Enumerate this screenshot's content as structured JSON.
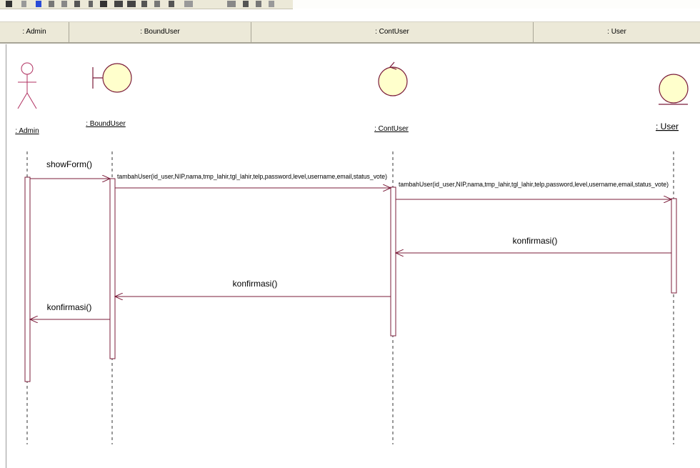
{
  "columns": [
    {
      "label": ": Admin"
    },
    {
      "label": ": BoundUser"
    },
    {
      "label": ": ContUser"
    },
    {
      "label": ": User"
    }
  ],
  "lifelines": [
    {
      "name": ": Admin",
      "kind": "actor-icon"
    },
    {
      "name": ": BoundUser",
      "kind": "boundary-icon"
    },
    {
      "name": ": ContUser",
      "kind": "control-icon"
    },
    {
      "name": ": User",
      "kind": "entity-icon"
    }
  ],
  "messages": [
    {
      "label": "showForm()"
    },
    {
      "label": "tambahUser(id_user,NIP,nama,tmp_lahir,tgl_lahir,telp,password,level,username,email,status_vote)"
    },
    {
      "label": "tambahUser(id_user,NIP,nama,tmp_lahir,tgl_lahir,telp,password,level,username,email,status_vote)"
    },
    {
      "label": "konfirmasi()"
    },
    {
      "label": "konfirmasi()"
    },
    {
      "label": "konfirmasi()"
    }
  ],
  "colors": {
    "lifeline_line": "#7b1c3a",
    "object_fill": "#ffffcc",
    "actor": "#b03060",
    "header_bg": "#ece9d8"
  }
}
